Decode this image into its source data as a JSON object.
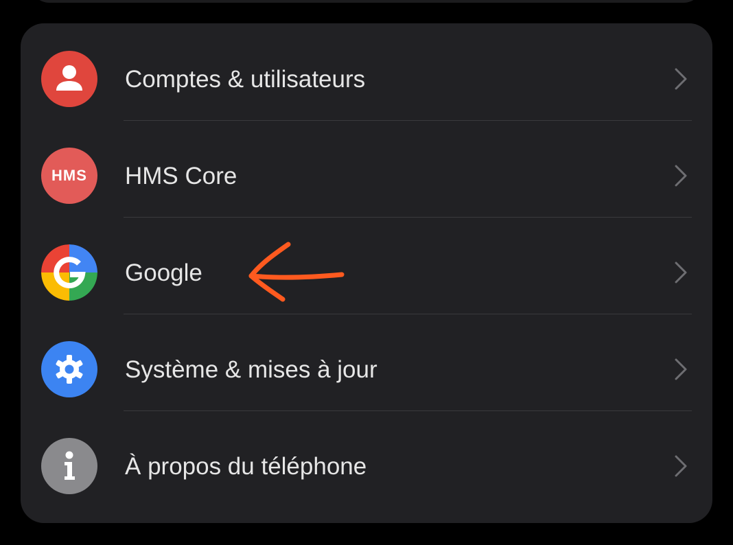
{
  "settings_list": {
    "items": [
      {
        "label": "Comptes & utilisateurs",
        "icon": "account-icon",
        "icon_color": "#e0463d"
      },
      {
        "label": "HMS Core",
        "icon": "hms-core-icon",
        "icon_color": "#e25b58",
        "icon_text": "HMS"
      },
      {
        "label": "Google",
        "icon": "google-icon",
        "icon_colors": [
          "#ea4335",
          "#fbbc04",
          "#34a853",
          "#4285f4"
        ]
      },
      {
        "label": "Système & mises à jour",
        "icon": "gear-icon",
        "icon_color": "#3c84f2"
      },
      {
        "label": "À propos du téléphone",
        "icon": "info-icon",
        "icon_color": "#8a8a8d"
      }
    ]
  },
  "annotation": {
    "type": "hand-drawn arrow",
    "points_to": "Google",
    "color": "#ff5a1f"
  },
  "colors": {
    "background": "#000000",
    "card": "#212124",
    "text": "#e6e6e6",
    "divider": "#3a3a3d",
    "chevron": "#6e6e72"
  }
}
